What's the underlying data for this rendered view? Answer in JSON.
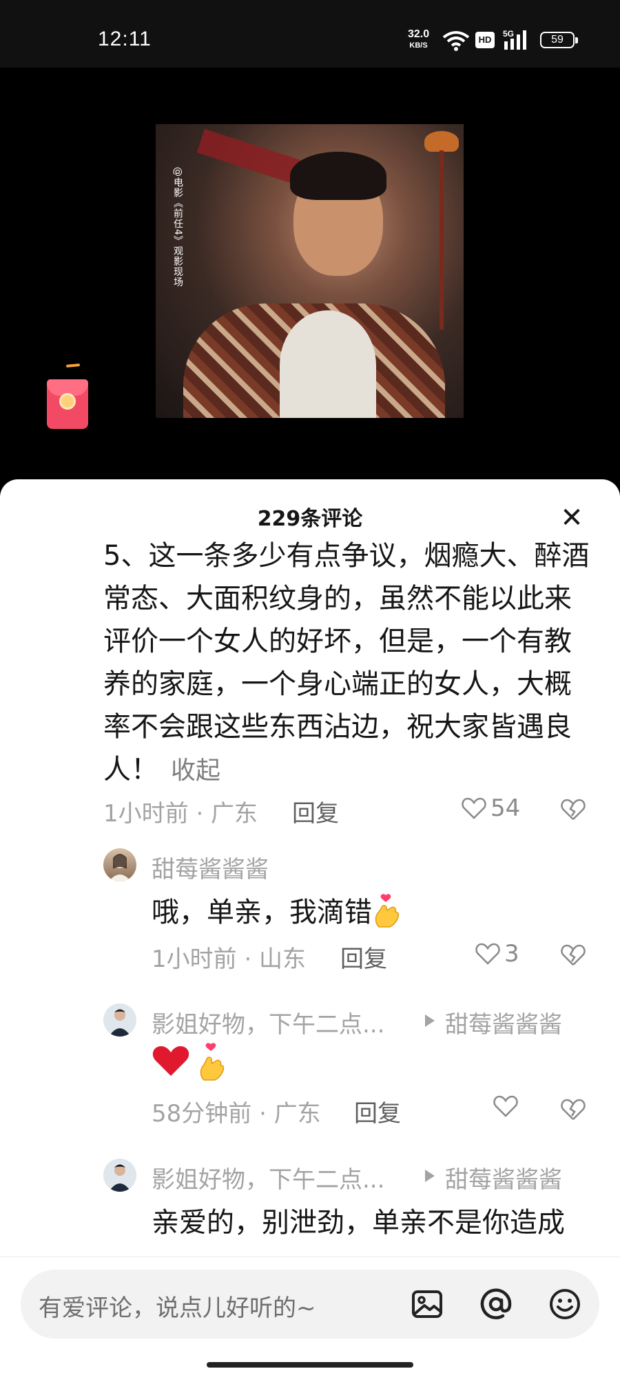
{
  "status_bar": {
    "time": "12:11",
    "net_speed_value": "32.0",
    "net_speed_unit": "KB/S",
    "hd_label": "HD",
    "network_type": "5G",
    "battery": "59"
  },
  "video": {
    "watermark": "@电影《前任4》观影现场"
  },
  "comments_sheet": {
    "title": "229条评论",
    "main_comment": {
      "text": "5、这一条多少有点争议，烟瘾大、醉酒常态、大面积纹身的，虽然不能以此来评价一个女人的好坏，但是，一个有教养的家庭，一个身心端正的女人，大概率不会跟这些东西沾边，祝大家皆遇良人！",
      "collapse_label": "收起",
      "meta": "1小时前 · 广东",
      "reply_label": "回复",
      "likes": "54"
    },
    "replies": [
      {
        "author": "甜莓酱酱酱",
        "text": "哦，单亲，我滴错",
        "meta": "1小时前 · 山东",
        "reply_label": "回复",
        "likes": "3"
      },
      {
        "author": "影姐好物，下午二点...",
        "reply_to": "甜莓酱酱酱",
        "meta": "58分钟前 · 广东",
        "reply_label": "回复",
        "likes": ""
      },
      {
        "author": "影姐好物，下午二点...",
        "reply_to": "甜莓酱酱酱",
        "text": "亲爱的，别泄劲，单亲不是你造成"
      }
    ]
  },
  "input_bar": {
    "placeholder": "有爱评论，说点儿好听的~",
    "icons": [
      "image-icon",
      "at-icon",
      "emoji-icon"
    ]
  }
}
